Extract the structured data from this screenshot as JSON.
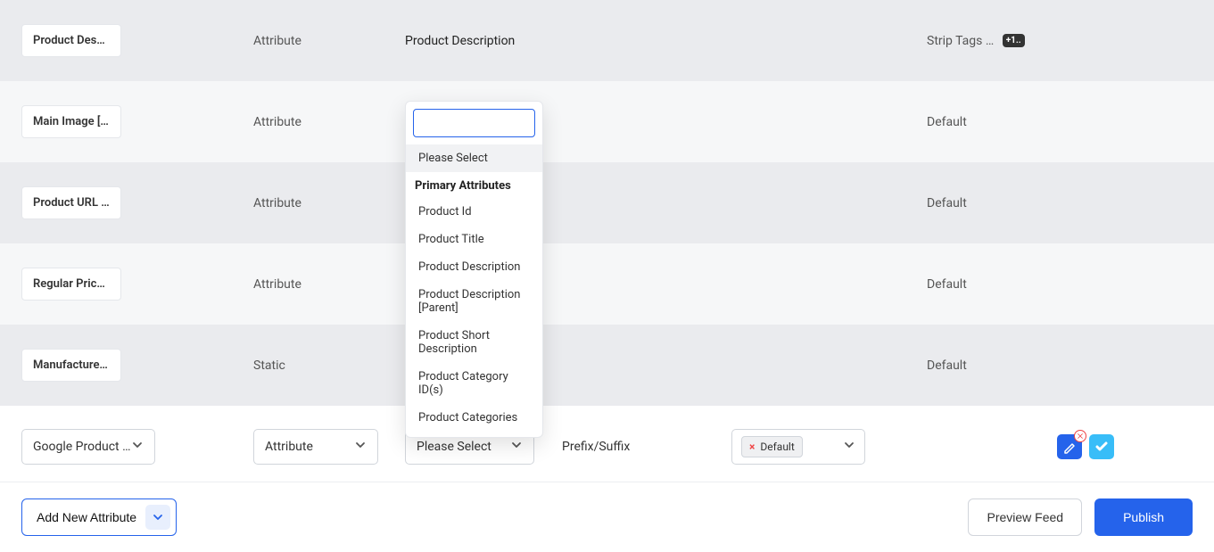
{
  "rows": [
    {
      "name": "Product Desc…",
      "type": "Attribute",
      "value": "Product Description",
      "output": "Strip Tags …",
      "badge": "+1..",
      "actions": [
        "edit"
      ]
    },
    {
      "name": "Main Image […",
      "type": "Attribute",
      "value": "",
      "output": "Default",
      "actions": [
        "edit"
      ]
    },
    {
      "name": "Product URL …",
      "type": "Attribute",
      "value": "",
      "output": "Default",
      "actions": [
        "edit"
      ]
    },
    {
      "name": "Regular Price…",
      "type": "Attribute",
      "value": "",
      "output": "Default",
      "actions": [
        "edit",
        "delete"
      ]
    },
    {
      "name": "Manufacture…",
      "type": "Static",
      "value": "",
      "output": "Default",
      "actions": [
        "edit"
      ]
    }
  ],
  "edit_row": {
    "name_select": "Google Product …",
    "type_select": "Attribute",
    "value_select": "Please Select",
    "prefix_label": "Prefix/Suffix",
    "output_chip": "Default"
  },
  "dropdown": {
    "placeholder_item": "Please Select",
    "group_label": "Primary Attributes",
    "items": [
      "Product Id",
      "Product Title",
      "Product Description",
      "Product Description [Parent]",
      "Product Short Description",
      "Product Category ID(s)",
      "Product Categories"
    ],
    "search_value": ""
  },
  "footer": {
    "add_label": "Add New Attribute",
    "preview_label": "Preview Feed",
    "publish_label": "Publish"
  }
}
